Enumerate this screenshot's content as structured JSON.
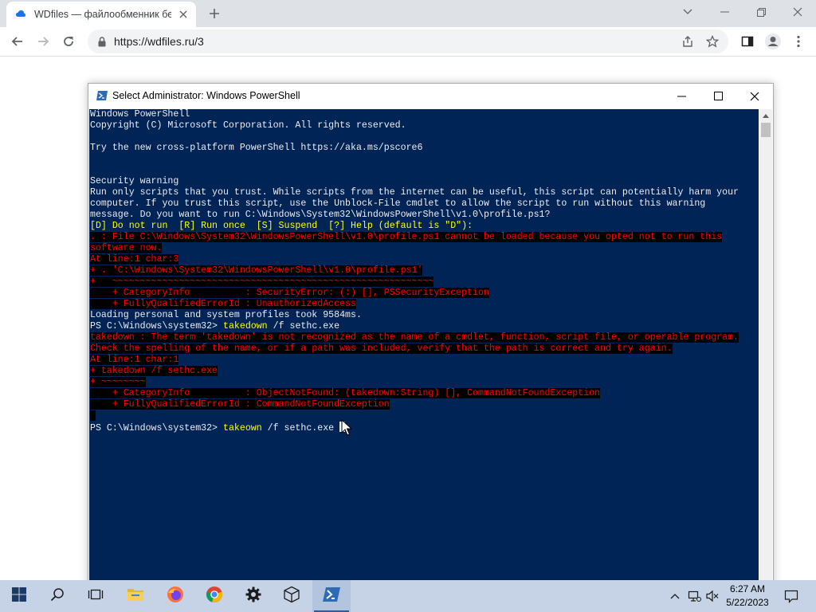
{
  "browser": {
    "tab_title": "WDfiles — файлообменник бес",
    "url": "https://wdfiles.ru/3"
  },
  "powershell": {
    "title": "Select Administrator: Windows PowerShell",
    "lines": [
      {
        "t": "Windows PowerShell",
        "s": "normal"
      },
      {
        "t": "Copyright (C) Microsoft Corporation. All rights reserved.",
        "s": "normal"
      },
      {
        "t": "",
        "s": "normal"
      },
      {
        "t": "Try the new cross-platform PowerShell https://aka.ms/pscore6",
        "s": "normal"
      },
      {
        "t": "",
        "s": "normal"
      },
      {
        "t": "",
        "s": "normal"
      },
      {
        "t": "Security warning",
        "s": "normal"
      },
      {
        "t": "Run only scripts that you trust. While scripts from the internet can be useful, this script can potentially harm your",
        "s": "normal"
      },
      {
        "t": "computer. If you trust this script, use the Unblock-File cmdlet to allow the script to run without this warning",
        "s": "normal"
      },
      {
        "t": "message. Do you want to run C:\\Windows\\System32\\WindowsPowerShell\\v1.0\\profile.ps1?",
        "s": "normal"
      },
      {
        "t": "[D] Do not run  [R] Run once  [S] Suspend  [?] Help (default is \"D\"):",
        "s": "yellow"
      },
      {
        "t": ". : File C:\\Windows\\System32\\WindowsPowerShell\\v1.0\\profile.ps1 cannot be loaded because you opted not to run this",
        "s": "err"
      },
      {
        "t": "software now.",
        "s": "err"
      },
      {
        "t": "At line:1 char:3",
        "s": "err"
      },
      {
        "t": "+ . 'C:\\Windows\\System32\\WindowsPowerShell\\v1.0\\profile.ps1'",
        "s": "err"
      },
      {
        "t": "+   ~~~~~~~~~~~~~~~~~~~~~~~~~~~~~~~~~~~~~~~~~~~~~~~~~~~~~~~~~~",
        "s": "err"
      },
      {
        "t": "    + CategoryInfo          : SecurityError: (:) [], PSSecurityException",
        "s": "err"
      },
      {
        "t": "    + FullyQualifiedErrorId : UnauthorizedAccess",
        "s": "err"
      },
      {
        "t": "Loading personal and system profiles took 9584ms.",
        "s": "normal"
      },
      {
        "p": "PS C:\\Windows\\system32> ",
        "c": "takedown",
        "r": " /f sethc.exe",
        "s": "prompt"
      },
      {
        "t": "takedown : The term 'takedown' is not recognized as the name of a cmdlet, function, script file, or operable program.",
        "s": "err"
      },
      {
        "t": "Check the spelling of the name, or if a path was included, verify that the path is correct and try again.",
        "s": "err"
      },
      {
        "t": "At line:1 char:1",
        "s": "err"
      },
      {
        "t": "+ takedown /f sethc.exe",
        "s": "err"
      },
      {
        "t": "+ ~~~~~~~~",
        "s": "err"
      },
      {
        "t": "    + CategoryInfo          : ObjectNotFound: (takedown:String) [], CommandNotFoundException",
        "s": "err"
      },
      {
        "t": "    + FullyQualifiedErrorId : CommandNotFoundException",
        "s": "err"
      },
      {
        "t": " ",
        "s": "err"
      },
      {
        "p": "PS C:\\Windows\\system32> ",
        "c": "takeown",
        "r": " /f sethc.exe ",
        "s": "prompt",
        "cursor": true
      }
    ]
  },
  "taskbar": {
    "time": "6:27 AM",
    "date": "5/22/2023",
    "pinned": [
      "start-icon",
      "search-icon",
      "task-view-icon",
      "file-explorer-icon",
      "firefox-icon",
      "chrome-icon",
      "settings-icon",
      "3d-box-icon",
      "powershell-icon"
    ]
  },
  "colors": {
    "console_bg": "#012456",
    "console_text": "#eeedf0",
    "command_yellow": "#ffff00",
    "error_red": "#ff0000",
    "error_bg": "#000000",
    "taskbar_bg": "#c6d3e6"
  }
}
